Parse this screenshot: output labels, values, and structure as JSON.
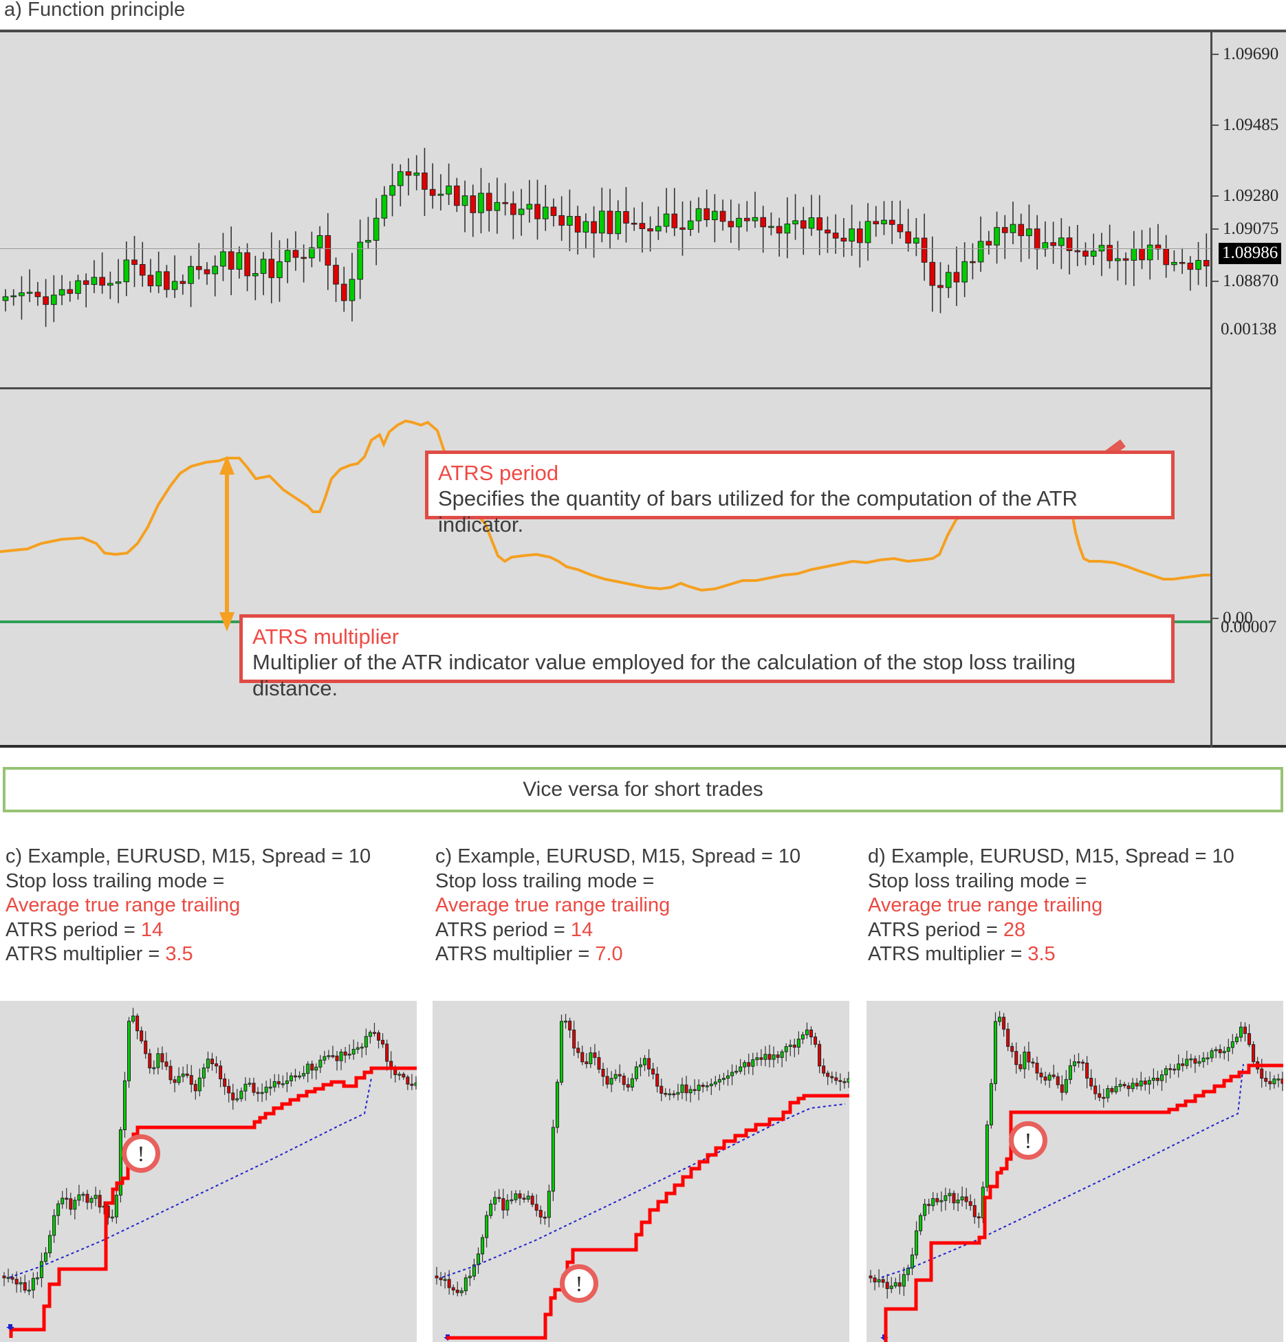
{
  "section_a": {
    "title": "a) Function principle"
  },
  "price_axis": {
    "labels": [
      "1.09690",
      "1.09485",
      "1.09280",
      "1.09075",
      "1.08870"
    ],
    "current": "1.08986"
  },
  "atr_axis": {
    "top": "0.00138",
    "zero": "0.00",
    "bottom": "0.00007"
  },
  "callouts": [
    {
      "title": "ATRS period",
      "body": "Specifies the quantity of bars utilized for the computation of the ATR indicator."
    },
    {
      "title": "ATRS multiplier",
      "body": "Multiplier of the ATR indicator value employed for the calculation of the stop loss trailing distance."
    }
  ],
  "vice_versa": "Vice versa for short trades",
  "examples": [
    {
      "head": "c) Example, EURUSD, M15, Spread = 10",
      "mode_label": "Stop loss trailing mode =",
      "mode_value": "Average true range trailing",
      "period_label": "ATRS period = ",
      "period_value": "14",
      "mult_label": "ATRS multiplier = ",
      "mult_value": "3.5",
      "warn_glyph": "!"
    },
    {
      "head": "c) Example, EURUSD, M15, Spread = 10",
      "mode_label": "Stop loss trailing mode =",
      "mode_value": "Average true range trailing",
      "period_label": "ATRS period = ",
      "period_value": "14",
      "mult_label": "ATRS multiplier = ",
      "mult_value": "7.0",
      "warn_glyph": "!"
    },
    {
      "head": "d) Example, EURUSD, M15, Spread = 10",
      "mode_label": "Stop loss trailing mode =",
      "mode_value": "Average true range trailing",
      "period_label": "ATRS period = ",
      "period_value": "28",
      "mult_label": "ATRS multiplier = ",
      "mult_value": "3.5",
      "warn_glyph": "!"
    }
  ],
  "colors": {
    "accent_red": "#eb4a42",
    "callout_border": "#e04b46",
    "atr_line": "#f5a020",
    "zero_line": "#2e9e55",
    "bull_candle": "#00cc00",
    "bear_candle": "#e00000",
    "stop_line": "#ff0000",
    "price_line": "#2222cc",
    "chart_bg": "#dcdcdc",
    "green_box": "#97c374"
  },
  "chart_data": {
    "type": "line",
    "title": "a) Function principle",
    "panels": [
      {
        "name": "price-candles",
        "kind": "candlestick",
        "symbol": "EURUSD",
        "ylabels": [
          "1.09690",
          "1.09485",
          "1.09280",
          "1.09075",
          "1.08870"
        ],
        "current_price": "1.08986"
      },
      {
        "name": "atr-indicator",
        "kind": "line",
        "ylabels": [
          "0.00138",
          "0.00",
          "0.00007"
        ],
        "series_color": "#f5a020",
        "zero_line_color": "#2e9e55",
        "annotation_arrow": "ATRS multiplier distance arrow (double headed, orange)"
      }
    ]
  }
}
